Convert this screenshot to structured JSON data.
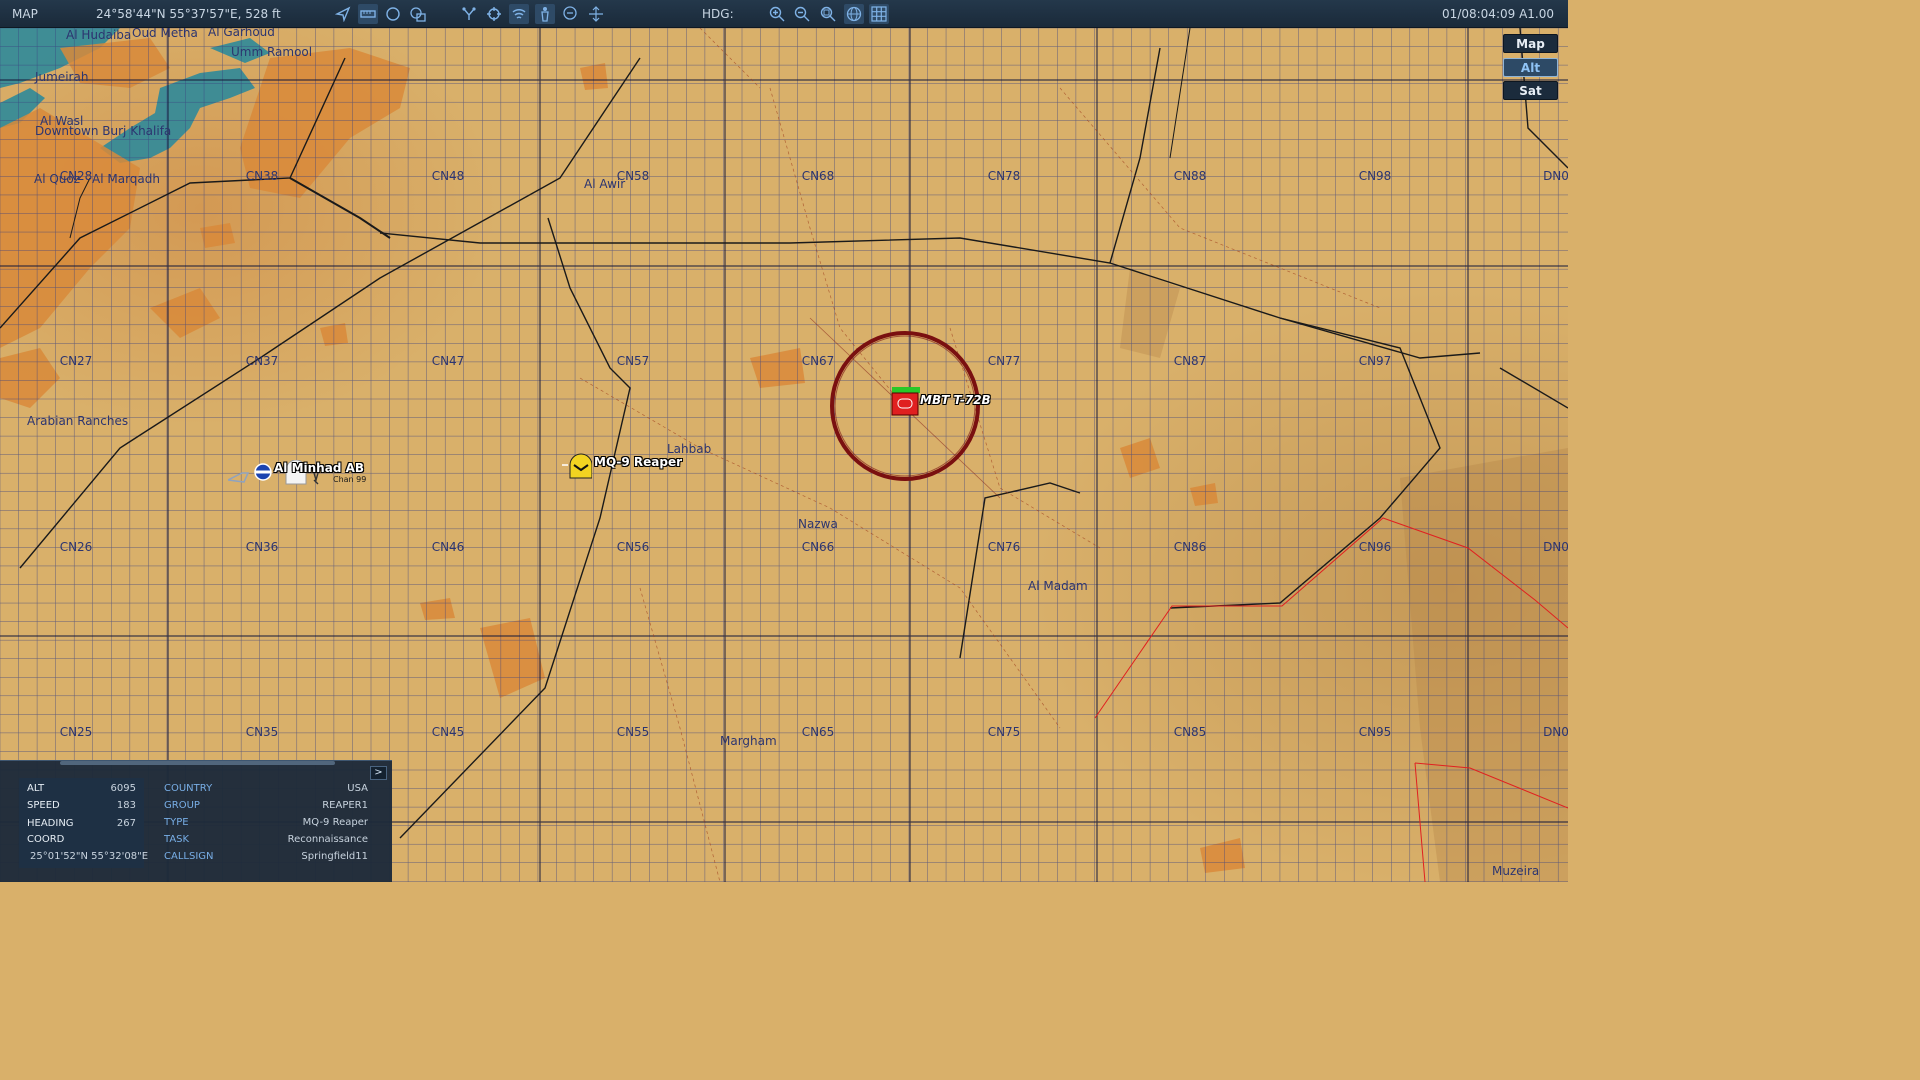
{
  "topbar": {
    "title": "MAP",
    "cursor_coord": "24°58'44\"N 55°37'57\"E, 528 ft",
    "hdg_label": "HDG:",
    "datetime": "01/08:04:09 A1.00",
    "icons": [
      "navigate-icon",
      "ruler-icon",
      "circle-tool-icon",
      "layers-icon",
      "waypoints-icon",
      "target-icon",
      "signal-icon",
      "unit-icon",
      "chat-icon",
      "pan-icon",
      "zoom-in-icon",
      "zoom-out-icon",
      "zoom-fit-icon",
      "globe-icon",
      "grid-icon"
    ]
  },
  "layers": {
    "map": "Map",
    "alt": "Alt",
    "sat": "Sat",
    "selected": "Alt"
  },
  "grid_labels": {
    "r1": [
      "CN28",
      "CN38",
      "CN48",
      "CN58",
      "CN68",
      "CN78",
      "CN88",
      "CN98",
      "DN0"
    ],
    "r2": [
      "CN27",
      "CN37",
      "CN47",
      "CN57",
      "CN67",
      "CN77",
      "CN87",
      "CN97"
    ],
    "r3": [
      "CN26",
      "CN36",
      "CN46",
      "CN56",
      "CN66",
      "CN76",
      "CN86",
      "CN96",
      "DN0"
    ],
    "r4": [
      "CN25",
      "CN35",
      "CN45",
      "CN55",
      "CN65",
      "CN75",
      "CN85",
      "CN95",
      "DN0"
    ]
  },
  "places": {
    "al_hudaiba": "Al Hudaiba",
    "oud_metha": "Oud Metha",
    "al_garhoud": "Al Garhoud",
    "umm_ramool": "Umm Ramool",
    "jumeirah": "Jumeirah",
    "al_wasl": "Al Wasl",
    "downtown": "Downtown Burj Khalifa",
    "al_quoz": "Al Quoz",
    "al_marqadh": "Al Marqadh",
    "al_awir": "Al Awir",
    "arabian_ranches": "Arabian Ranches",
    "lahbab": "Lahbab",
    "nazwa": "Nazwa",
    "al_madam": "Al Madam",
    "margham": "Margham",
    "muzeira": "Muzeira"
  },
  "units": {
    "reaper": "MQ-9 Reaper",
    "target": "MBT T-72B",
    "airbase": "Al Minhad AB",
    "airbase_chan": "Chan 99"
  },
  "info_panel": {
    "expand_label": ">",
    "left": [
      {
        "key": "ALT",
        "value": "6095"
      },
      {
        "key": "SPEED",
        "value": "183"
      },
      {
        "key": "HEADING",
        "value": "267"
      },
      {
        "key": "COORD",
        "value": ""
      }
    ],
    "coord_value": "25°01'52\"N 55°32'08\"E",
    "right": [
      {
        "key": "COUNTRY",
        "value": "USA"
      },
      {
        "key": "GROUP",
        "value": "REAPER1"
      },
      {
        "key": "TYPE",
        "value": "MQ-9 Reaper"
      },
      {
        "key": "TASK",
        "value": "Reconnaissance"
      },
      {
        "key": "CALLSIGN",
        "value": "Springfield11"
      }
    ]
  },
  "colors": {
    "map_bg": "#d9b06a",
    "grid": "#2c3570",
    "urban": "#d98a3a",
    "water": "#2f8a9a",
    "target_ring": "#7a1010",
    "hostile": "#e02020",
    "friendly_yellow": "#f2d321",
    "border_red": "#e02020"
  }
}
